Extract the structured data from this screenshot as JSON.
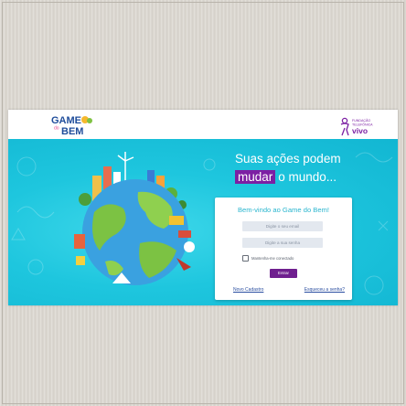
{
  "header": {
    "brand_logo": "game-do-bem-logo",
    "partner_logo": "fundacao-telefonica-vivo-logo",
    "partner_text": [
      "FUNDAÇÃO",
      "TELEFÔNICA",
      "vivo"
    ]
  },
  "hero": {
    "tagline_line1": "Suas ações podem",
    "tagline_highlight": "mudar",
    "tagline_line2_rest": "o mundo...",
    "illustration": "earth-globe-illustration"
  },
  "login": {
    "title": "Bem-vindo ao Game do Bem!",
    "email_placeholder": "Digite o seu email",
    "password_placeholder": "Digite a sua senha",
    "remember_label": "Mantenha-me conectado",
    "submit_label": "Entrar",
    "register_link": "Novo Cadastro",
    "forgot_link": "Esqueceu a senha?"
  },
  "colors": {
    "hero_background": "#1ec6de",
    "accent_purple": "#6f1f8f",
    "card_title": "#2bb6cf",
    "link_blue": "#2a4ea0"
  }
}
